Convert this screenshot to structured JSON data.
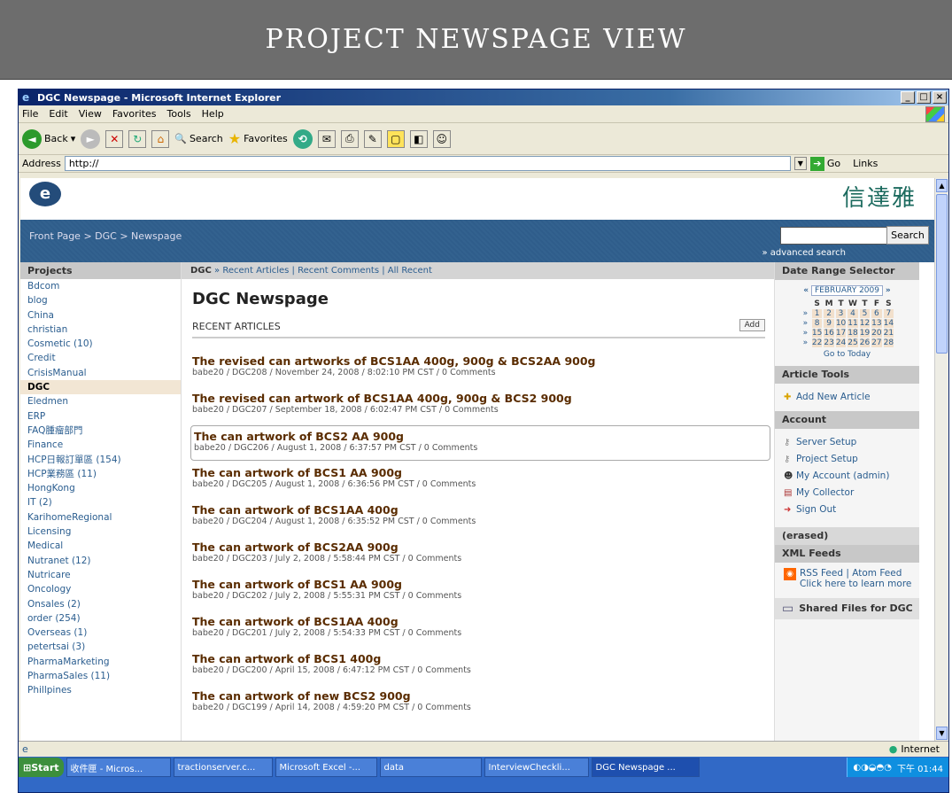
{
  "slide_title": "PROJECT NEWSPAGE VIEW",
  "window": {
    "title": "DGC Newspage - Microsoft Internet Explorer",
    "menu": [
      "File",
      "Edit",
      "View",
      "Favorites",
      "Tools",
      "Help"
    ],
    "toolbar": {
      "back": "Back",
      "search": "Search",
      "favorites": "Favorites"
    },
    "address_label": "Address",
    "address_value": "http://",
    "go": "Go",
    "links": "Links"
  },
  "site": {
    "brand_cn": "信達雅",
    "breadcrumb": "Front Page > DGC > Newspage",
    "search_button": "Search",
    "advanced_search": "» advanced search"
  },
  "projects": {
    "heading": "Projects",
    "items": [
      "Bdcom",
      "blog",
      "China",
      "christian",
      "Cosmetic (10)",
      "Credit",
      "CrisisManual",
      "DGC",
      "Eledmen",
      "ERP",
      "FAQ腫瘤部門",
      "Finance",
      "HCP日報訂單區 (154)",
      "HCP業務區 (11)",
      "HongKong",
      "IT (2)",
      "KarihomeRegional",
      "Licensing",
      "Medical",
      "Nutranet (12)",
      "Nutricare",
      "Oncology",
      "Onsales (2)",
      "order (254)",
      "Overseas (1)",
      "petertsai (3)",
      "PharmaMarketing",
      "PharmaSales (11)",
      "Phillpines"
    ],
    "active": "DGC"
  },
  "main": {
    "subnav": {
      "prefix": "DGC",
      "sep": " » ",
      "rest": "Recent Articles | Recent Comments | All Recent"
    },
    "title": "DGC Newspage",
    "recent_label": "RECENT ARTICLES",
    "add_label": "Add",
    "articles": [
      {
        "title": "The revised can artworks of BCS1AA 400g, 900g & BCS2AA 900g",
        "meta": "babe20 / DGC208 / November 24, 2008 / 8:02:10 PM CST / 0 Comments"
      },
      {
        "title": "The revised can artwork of BCS1AA 400g, 900g & BCS2 900g",
        "meta": "babe20 / DGC207 / September 18, 2008 / 6:02:47 PM CST / 0 Comments"
      },
      {
        "title": "The can artwork of BCS2 AA 900g",
        "meta": "babe20 / DGC206 / August 1, 2008 / 6:37:57 PM CST / 0 Comments"
      },
      {
        "title": "The can artwork of BCS1 AA 900g",
        "meta": "babe20 / DGC205 / August 1, 2008 / 6:36:56 PM CST / 0 Comments"
      },
      {
        "title": "The can artwork of BCS1AA 400g",
        "meta": "babe20 / DGC204 / August 1, 2008 / 6:35:52 PM CST / 0 Comments"
      },
      {
        "title": "The can artwork of BCS2AA 900g",
        "meta": "babe20 / DGC203 / July 2, 2008 / 5:58:44 PM CST / 0 Comments"
      },
      {
        "title": "The can artwork of BCS1 AA 900g",
        "meta": "babe20 / DGC202 / July 2, 2008 / 5:55:31 PM CST / 0 Comments"
      },
      {
        "title": "The can artwork of BCS1AA 400g",
        "meta": "babe20 / DGC201 / July 2, 2008 / 5:54:33 PM CST / 0 Comments"
      },
      {
        "title": "The can artwork of BCS1 400g",
        "meta": "babe20 / DGC200 / April 15, 2008 / 6:47:12 PM CST / 0 Comments"
      },
      {
        "title": "The can artwork of new BCS2 900g",
        "meta": "babe20 / DGC199 / April 14, 2008 / 4:59:20 PM CST / 0 Comments"
      }
    ]
  },
  "right": {
    "date_heading": "Date Range Selector",
    "calendar": {
      "month": "FEBRUARY 2009",
      "days": [
        "S",
        "M",
        "T",
        "W",
        "T",
        "F",
        "S"
      ],
      "weeks": [
        [
          "1",
          "2",
          "3",
          "4",
          "5",
          "6",
          "7"
        ],
        [
          "8",
          "9",
          "10",
          "11",
          "12",
          "13",
          "14"
        ],
        [
          "15",
          "16",
          "17",
          "18",
          "19",
          "20",
          "21"
        ],
        [
          "22",
          "23",
          "24",
          "25",
          "26",
          "27",
          "28"
        ]
      ],
      "today": "Go to Today"
    },
    "tools_heading": "Article Tools",
    "add_new": "Add New Article",
    "account_heading": "Account",
    "account_items": [
      "Server Setup",
      "Project Setup",
      "My Account (admin)",
      "My Collector",
      "Sign Out"
    ],
    "erased": "(erased)",
    "xml_heading": "XML Feeds",
    "rss": "RSS Feed | Atom Feed",
    "learn": "Click here to learn more",
    "shared": "Shared Files for DGC"
  },
  "statusbar": {
    "zone": "Internet"
  },
  "taskbar": {
    "start": "Start",
    "tasks": [
      "收件匣 - Micros...",
      "tractionserver.c...",
      "Microsoft Excel -...",
      "data",
      "InterviewCheckli...",
      "DGC Newspage ..."
    ],
    "clock": "下午 01:44"
  }
}
